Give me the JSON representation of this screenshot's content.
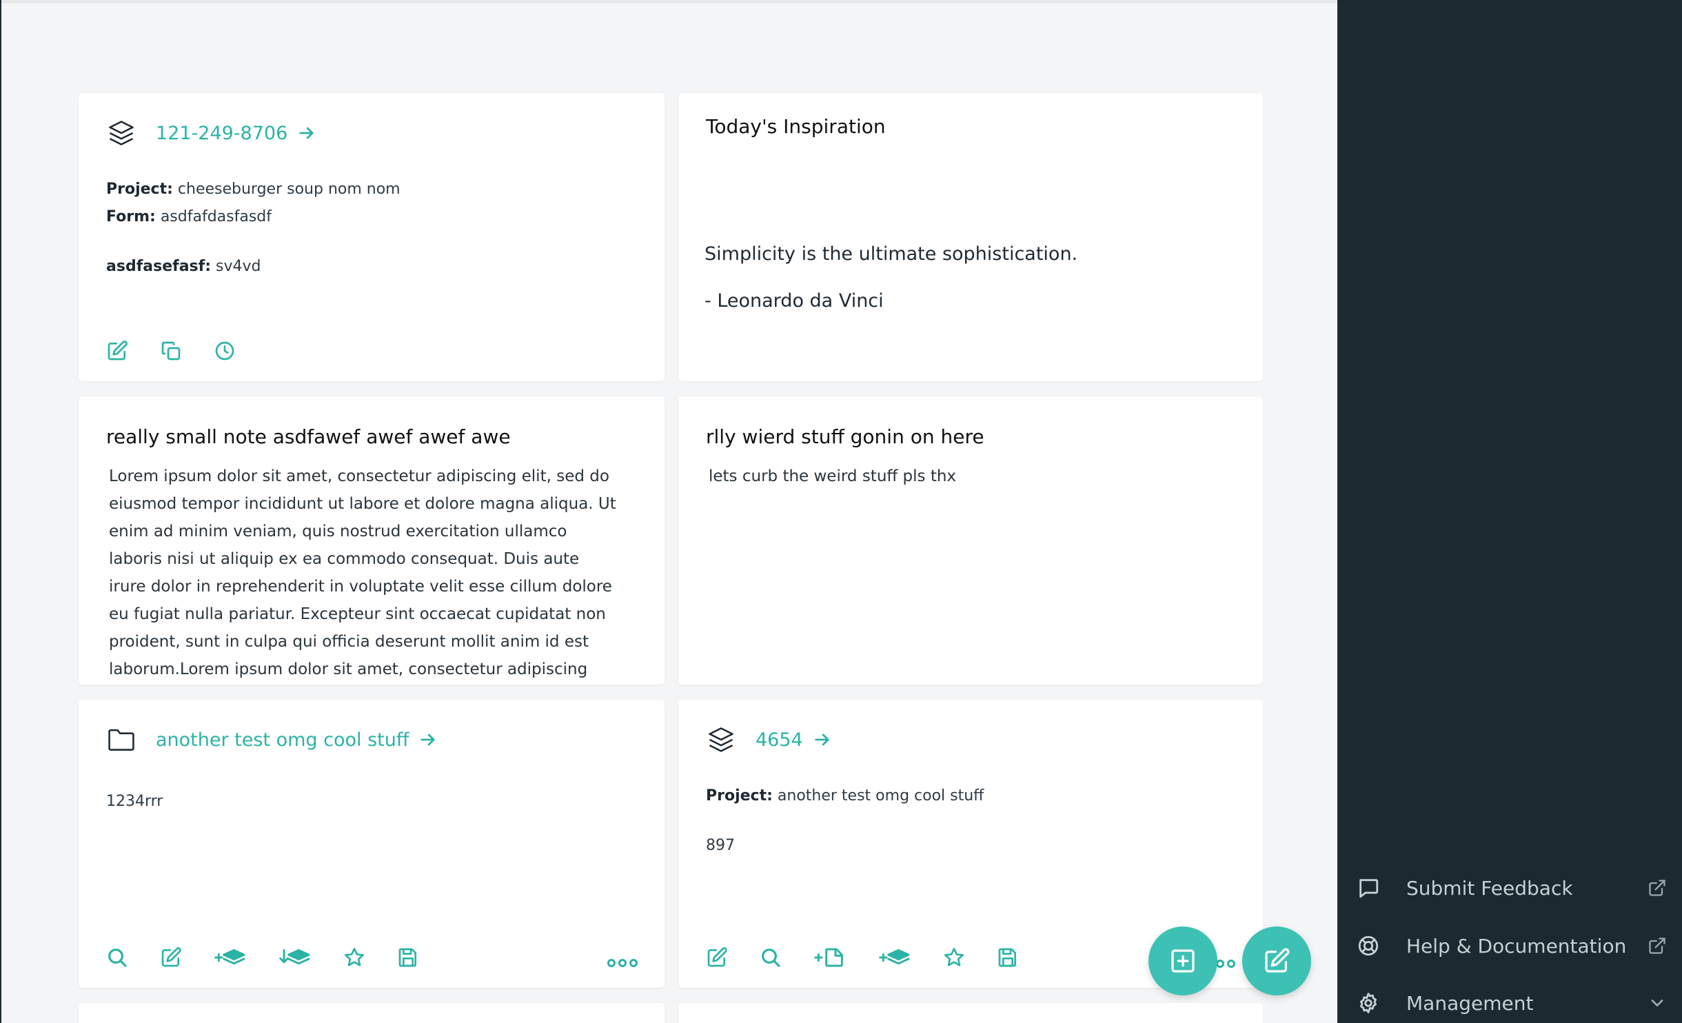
{
  "cards": {
    "form_entry": {
      "link": "121-249-8706",
      "project_label": "Project:",
      "project_value": "cheeseburger soup nom nom",
      "form_label": "Form:",
      "form_value": "asdfafdasfasdf",
      "field_label": "asdfasefasf:",
      "field_value": "sv4vd",
      "icon": "layers-icon"
    },
    "inspiration": {
      "title": "Today's Inspiration",
      "quote": "Simplicity is the ultimate sophistication.",
      "author": "- Leonardo da Vinci"
    },
    "note_small": {
      "title": "really small note asdfawef awef awef awe",
      "body": "Lorem ipsum dolor sit amet, consectetur adipiscing elit, sed do eiusmod tempor incididunt ut labore et dolore magna aliqua. Ut enim ad minim veniam, quis nostrud exercitation ullamco laboris nisi ut aliquip ex ea commodo consequat. Duis aute irure dolor in reprehenderit in voluptate velit esse cillum dolore eu fugiat nulla pariatur. Excepteur sint occaecat cupidatat non proident, sunt in culpa qui officia deserunt mollit anim id est laborum.Lorem ipsum dolor sit amet, consectetur adipiscing elit, sed do eiusmod tempor"
    },
    "note_weird": {
      "title": "rlly wierd stuff gonin on here",
      "body": "lets curb the weird stuff pls thx"
    },
    "project": {
      "link": "another test omg cool stuff",
      "value": "1234rrr",
      "icon": "folder-icon"
    },
    "form_entry_2": {
      "link": "4654",
      "project_label": "Project:",
      "project_value": "another test omg cool stuff",
      "value": "897",
      "icon": "layers-icon"
    }
  },
  "sidebar": {
    "items": [
      {
        "label": "Submit Feedback",
        "icon": "chat-icon",
        "trailing": "external-link-icon"
      },
      {
        "label": "Help & Documentation",
        "icon": "lifebuoy-icon",
        "trailing": "external-link-icon"
      },
      {
        "label": "Management",
        "icon": "gear-icon",
        "trailing": "chevron-down-icon"
      }
    ]
  },
  "colors": {
    "accent": "#2bb3a6",
    "fab": "#3cc1b4",
    "sidebar_bg": "#1b2a31",
    "page_bg": "#f4f5f6"
  }
}
